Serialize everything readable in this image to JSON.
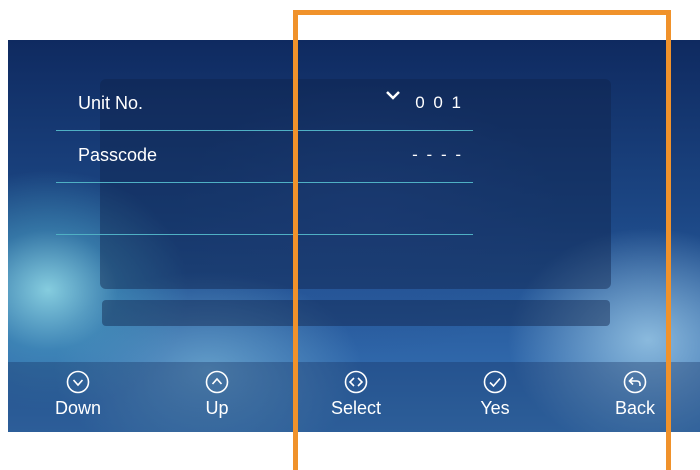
{
  "form": {
    "unit_label": "Unit No.",
    "unit_value": "0 0 1",
    "passcode_label": "Passcode",
    "passcode_value": "- - - -"
  },
  "bottom_bar": {
    "down": "Down",
    "up": "Up",
    "select": "Select",
    "yes": "Yes",
    "back": "Back"
  },
  "icons": {
    "caret": "chevron-down-icon",
    "down": "circle-chevron-down-icon",
    "up": "circle-chevron-up-icon",
    "select": "circle-left-right-icon",
    "yes": "circle-check-icon",
    "back": "circle-back-arrow-icon"
  },
  "colors": {
    "highlight_frame": "#f0922b",
    "separator": "#4fb0c4",
    "text": "#ffffff"
  }
}
